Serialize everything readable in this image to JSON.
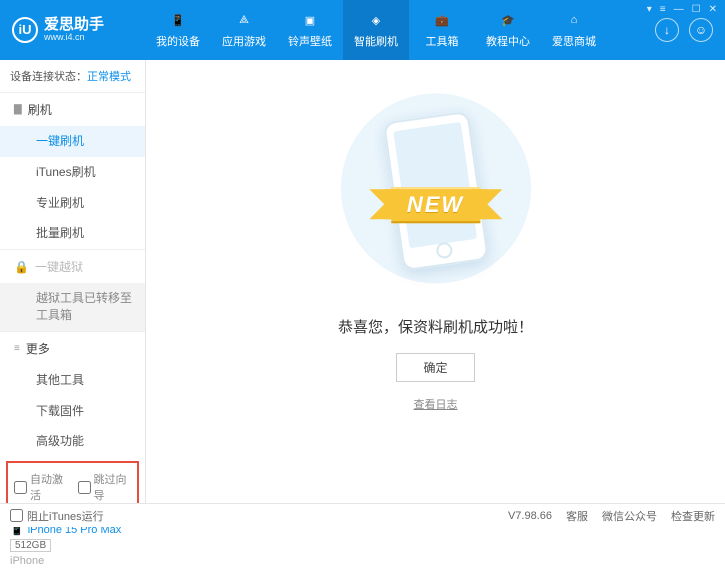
{
  "header": {
    "logo_letter": "iU",
    "title": "爱思助手",
    "url": "www.i4.cn",
    "nav": [
      {
        "label": "我的设备"
      },
      {
        "label": "应用游戏"
      },
      {
        "label": "铃声壁纸"
      },
      {
        "label": "智能刷机"
      },
      {
        "label": "工具箱"
      },
      {
        "label": "教程中心"
      },
      {
        "label": "爱思商城"
      }
    ]
  },
  "status": {
    "label": "设备连接状态：",
    "value": "正常模式"
  },
  "sidebar": {
    "flash": {
      "head": "刷机",
      "items": [
        "一键刷机",
        "iTunes刷机",
        "专业刷机",
        "批量刷机"
      ]
    },
    "jailbreak": {
      "head": "一键越狱",
      "note": "越狱工具已转移至工具箱"
    },
    "more": {
      "head": "更多",
      "items": [
        "其他工具",
        "下载固件",
        "高级功能"
      ]
    },
    "checks": {
      "auto_activate": "自动激活",
      "skip_guide": "跳过向导"
    }
  },
  "device": {
    "name": "iPhone 15 Pro Max",
    "capacity": "512GB",
    "model": "iPhone"
  },
  "main": {
    "ribbon": "NEW",
    "success": "恭喜您，保资料刷机成功啦！",
    "confirm": "确定",
    "log_link": "查看日志"
  },
  "footer": {
    "block_itunes": "阻止iTunes运行",
    "version": "V7.98.66",
    "kf": "客服",
    "wx": "微信公众号",
    "update": "检查更新"
  }
}
